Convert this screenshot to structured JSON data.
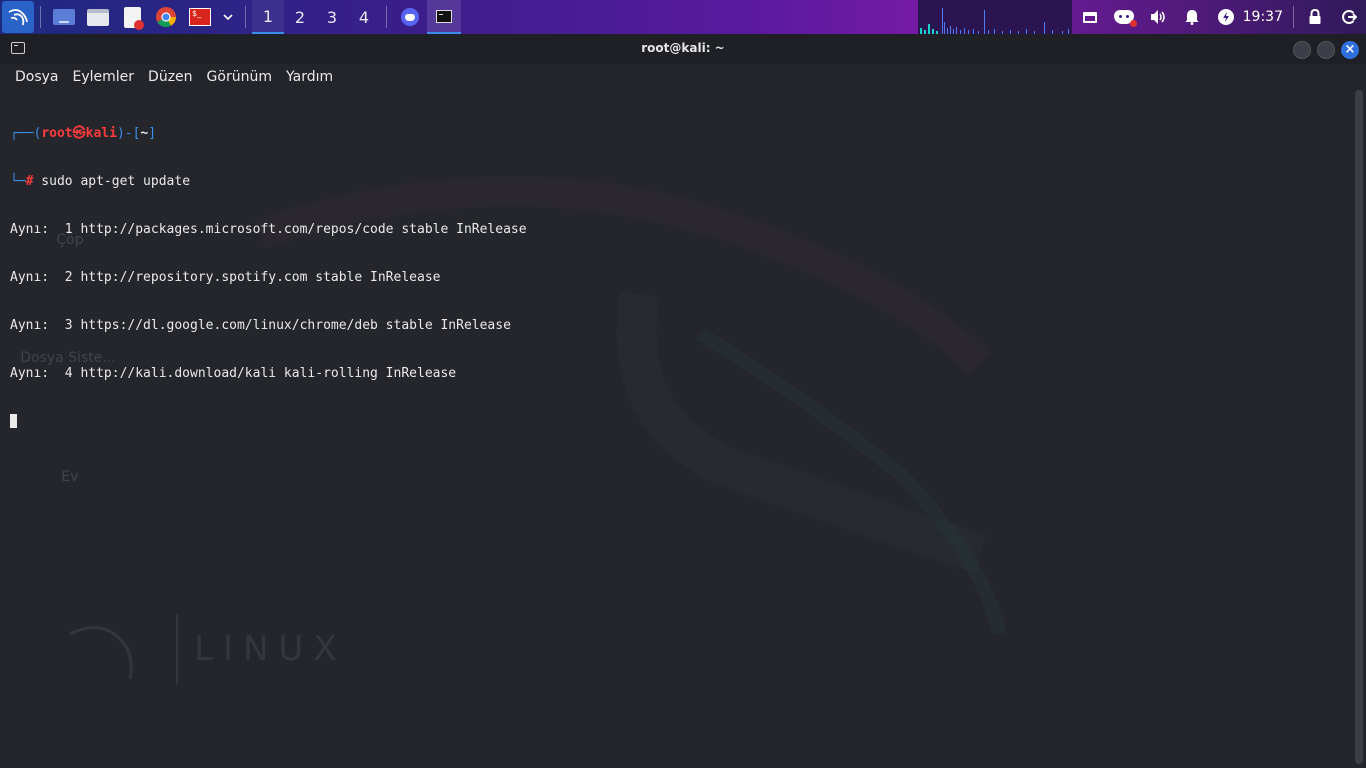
{
  "panel": {
    "workspaces": [
      "1",
      "2",
      "3",
      "4"
    ],
    "active_workspace": "1",
    "clock": "19:37",
    "launchers": [
      "kali-menu-icon",
      "desktop-icon",
      "file-manager-icon",
      "text-editor-icon",
      "chrome-icon",
      "terminal-red-icon",
      "dropdown-chevron-icon"
    ],
    "tasks": [
      "discord-icon",
      "terminal-icon"
    ],
    "tray": [
      "display-icon",
      "discord-tray-icon",
      "volume-icon",
      "notification-bell-icon",
      "power-manager-icon",
      "lock-icon",
      "logout-icon"
    ]
  },
  "window": {
    "title": "root@kali: ~",
    "menu": [
      "Dosya",
      "Eylemler",
      "Düzen",
      "Görünüm",
      "Yardım"
    ]
  },
  "desktop": {
    "icons": [
      "Çöp",
      "Dosya Siste...",
      "Ev"
    ],
    "watermark": "LINUX"
  },
  "terminal": {
    "prompt_open": "┌──(",
    "prompt_user": "root㉿kali",
    "prompt_mid": ")-[",
    "prompt_dir": "~",
    "prompt_close": "]",
    "prompt_second": "└─",
    "prompt_hash": "#",
    "command": " sudo apt-get update",
    "output": [
      "Aynı:  1 http://packages.microsoft.com/repos/code stable InRelease",
      "Aynı:  2 http://repository.spotify.com stable InRelease",
      "Aynı:  3 https://dl.google.com/linux/chrome/deb stable InRelease",
      "Aynı:  4 http://kali.download/kali kali-rolling InRelease"
    ]
  },
  "colors": {
    "accent": "#3d8be8",
    "prompt_blue": "#3b8eea",
    "prompt_red": "#ff3b3b"
  }
}
